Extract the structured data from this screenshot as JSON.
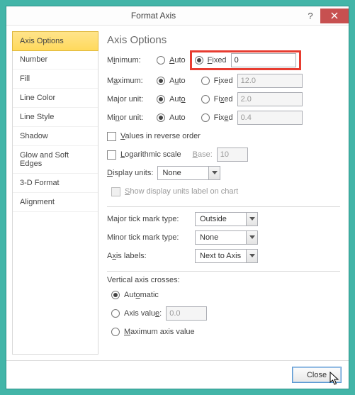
{
  "title": "Format Axis",
  "sidebar": {
    "items": [
      {
        "label": "Axis Options"
      },
      {
        "label": "Number"
      },
      {
        "label": "Fill"
      },
      {
        "label": "Line Color"
      },
      {
        "label": "Line Style"
      },
      {
        "label": "Shadow"
      },
      {
        "label": "Glow and Soft Edges"
      },
      {
        "label": "3-D Format"
      },
      {
        "label": "Alignment"
      }
    ]
  },
  "content": {
    "heading": "Axis Options",
    "minimum_label": "Minimum:",
    "maximum_label": "Maximum:",
    "major_label": "Major unit:",
    "minor_label": "Minor unit:",
    "auto_label_A": "Auto",
    "auto_label_u": "Auto",
    "auto_label_o": "Auto",
    "auto_label_maj": "Auto",
    "fixed_label_F": "Fixed",
    "fixed_label_I": "Fixed",
    "fixed_label_x": "Fixed",
    "fixed_label_e": "Fixed",
    "min_value": "0",
    "max_value": "12.0",
    "major_value": "2.0",
    "minor_value": "0.4",
    "values_reverse": "Values in reverse order",
    "log_scale": "Logarithmic scale",
    "log_base_label": "Base:",
    "log_base_value": "10",
    "display_units_label": "Display units:",
    "display_units_value": "None",
    "show_units_label": "Show display units label on chart",
    "major_tick_label": "Major tick mark type:",
    "major_tick_value": "Outside",
    "minor_tick_label": "Minor tick mark type:",
    "minor_tick_value": "None",
    "axis_labels_label": "Axis labels:",
    "axis_labels_value": "Next to Axis",
    "vcross_label": "Vertical axis crosses:",
    "vcross_auto": "Automatic",
    "vcross_value_label": "Axis value:",
    "vcross_value": "0.0",
    "vcross_max": "Maximum axis value"
  },
  "footer": {
    "close": "Close"
  }
}
